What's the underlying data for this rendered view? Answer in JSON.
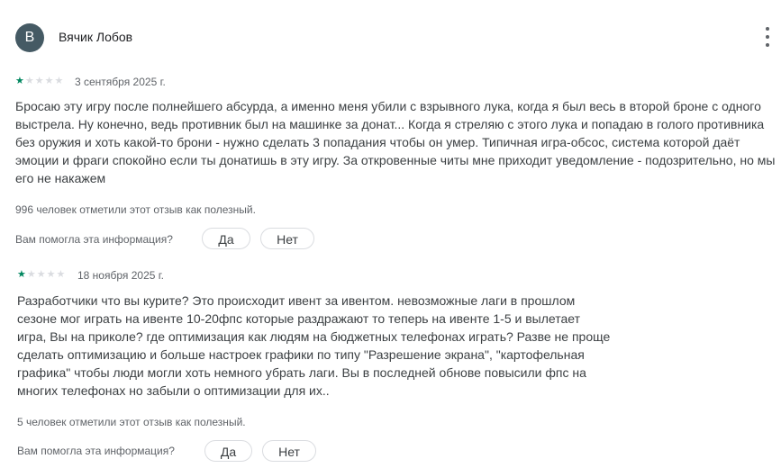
{
  "author": {
    "initial": "В",
    "name": "Вячик Лобов"
  },
  "reviews": [
    {
      "rating": 1,
      "date": "3 сентября 2025 г.",
      "text": "Бросаю эту игру после полнейшего абсурда, а именно меня убили с взрывного лука, когда я был весь в второй броне с одного выстрела. Ну конечно, ведь противник был на машинке за донат... Когда я стреляю с этого лука и попадаю в голого противника без оружия и хоть какой-то брони - нужно сделать 3 попадания чтобы он умер. Типичная игра-обсос, система которой даёт эмоции и фраги спокойно если ты донатишь в эту игру. За откровенные читы мне приходит уведомление - подозрительно, но мы его не накажем",
      "helpful": "996 человек отметили этот отзыв как полезный.",
      "question": "Вам помогла эта информация?",
      "yes": "Да",
      "no": "Нет"
    },
    {
      "rating": 1,
      "date": "18 ноября 2025 г.",
      "text": "Разработчики что вы курите? Это происходит ивент за ивентом. невозможные лаги в прошлом сезоне мог играть на ивенте 10-20фпс которые раздражают то теперь на ивенте 1-5 и вылетает игра, Вы на приколе? где оптимизация как людям на бюджетных телефонах играть? Разве не проще сделать оптимизацию и больше настроек графики по типу \"Разрешение экрана\", \"картофельная графика\" чтобы люди могли хоть немного убрать лаги. Вы в последней обнове повысили фпс на многих телефонах но забыли о оптимизации для их..",
      "helpful": "5 человек отметили этот отзыв как полезный.",
      "question": "Вам помогла эта информация?",
      "yes": "Да",
      "no": "Нет"
    }
  ],
  "icons": {
    "star": "star-icon",
    "more": "more-vert-icon"
  },
  "colors": {
    "star_on": "#01875f",
    "star_off": "#dadce0",
    "avatar": "#455a64"
  }
}
